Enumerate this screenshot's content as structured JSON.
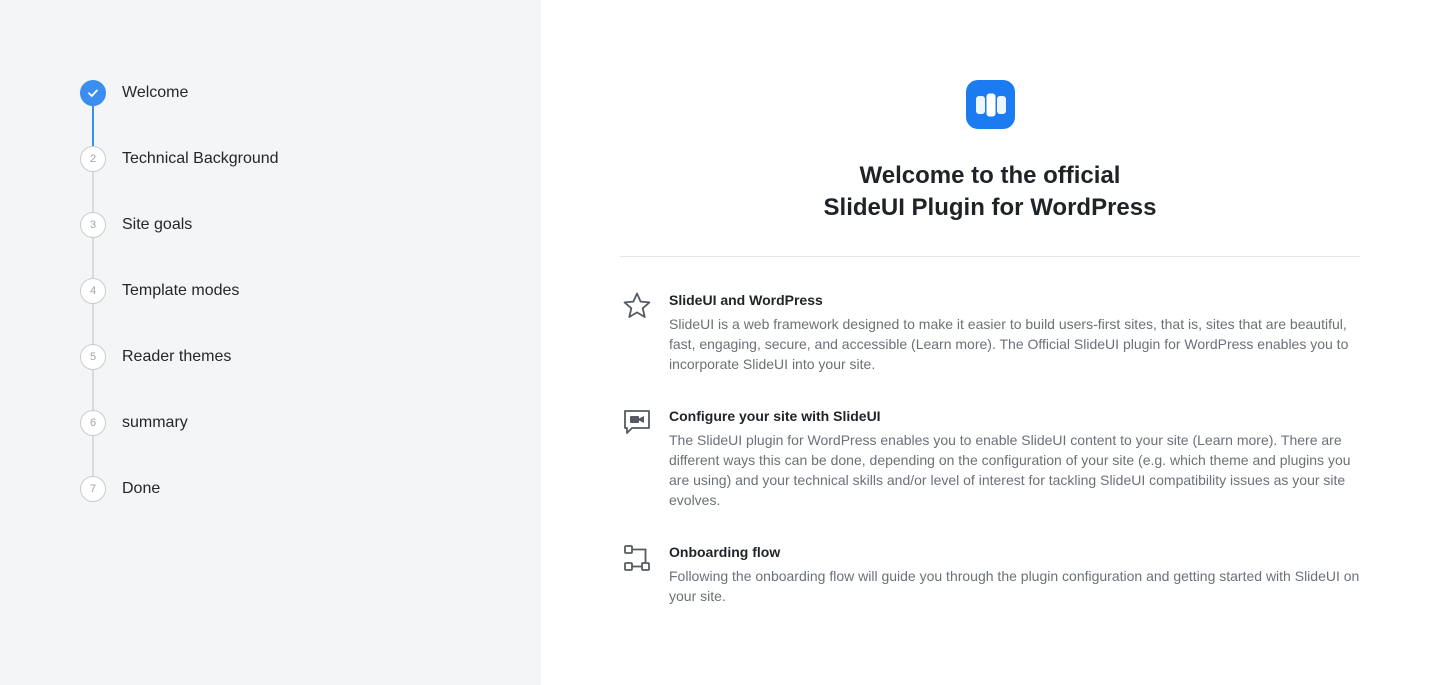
{
  "sidebar": {
    "steps": [
      {
        "number": "",
        "label": "Welcome",
        "status": "done"
      },
      {
        "number": "2",
        "label": "Technical Background",
        "status": "pending"
      },
      {
        "number": "3",
        "label": "Site goals",
        "status": "pending"
      },
      {
        "number": "4",
        "label": "Template modes",
        "status": "pending"
      },
      {
        "number": "5",
        "label": "Reader themes",
        "status": "pending"
      },
      {
        "number": "6",
        "label": "summary",
        "status": "pending"
      },
      {
        "number": "7",
        "label": "Done",
        "status": "pending"
      }
    ]
  },
  "main": {
    "logo_icon": "slideui-logo-icon",
    "title_line1": "Welcome to the official",
    "title_line2": "SlideUI Plugin for WordPress",
    "features": [
      {
        "icon": "star-icon",
        "title": "SlideUI and WordPress",
        "description": "SlideUI is a web framework designed to make it easier to build users-first sites, that is, sites that are beautiful, fast, engaging, secure, and accessible (Learn more). The Official SlideUI plugin for WordPress enables you to incorporate SlideUI into your site."
      },
      {
        "icon": "video-chat-icon",
        "title": "Configure your site with SlideUI",
        "description": "The SlideUI plugin for WordPress enables you to enable SlideUI content to your site (Learn more). There are different ways this can be done, depending on the configuration of your site (e.g. which theme and plugins you are using) and your technical skills and/or level of interest for tackling SlideUI compatibility issues as your site evolves."
      },
      {
        "icon": "flow-icon",
        "title": "Onboarding flow",
        "description": "Following the onboarding flow will guide you through the plugin configuration and getting started with SlideUI on your site."
      }
    ]
  },
  "colors": {
    "accent": "#3b8ef0",
    "brand": "#1a7cf0",
    "sidebar_bg": "#f4f5f6"
  }
}
